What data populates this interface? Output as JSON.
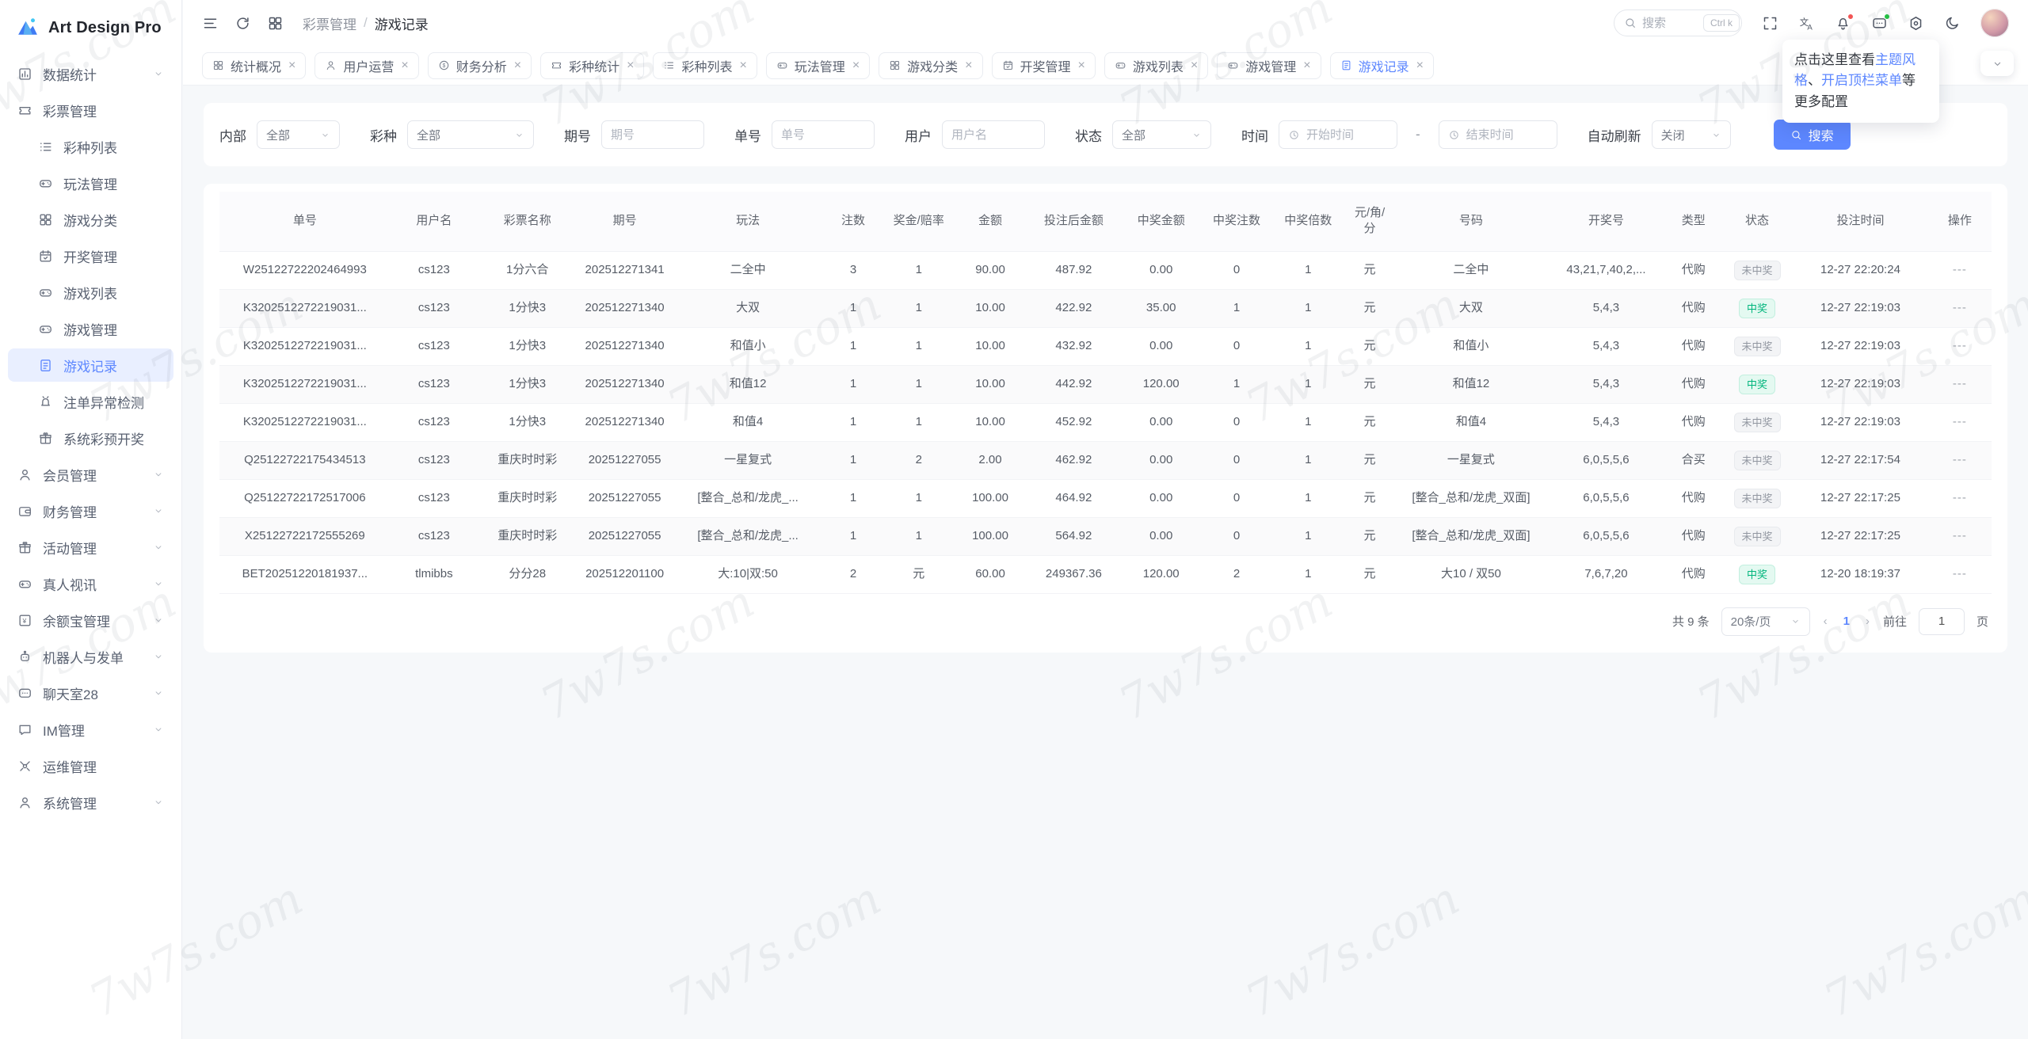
{
  "app": {
    "name": "Art Design Pro"
  },
  "watermark_text": "7w7s.com",
  "colors": {
    "accent": "#5d87ff",
    "win_text": "#00b57c",
    "win_bg": "#e4f9f1",
    "lose_text": "#9297a1",
    "lose_bg": "#f3f4f6",
    "dot_red": "#f25555",
    "dot_green": "#23c343"
  },
  "sidebar": {
    "items": [
      {
        "label": "数据统计",
        "icon": "bar-chart-icon",
        "level": 1,
        "chevron": true,
        "active": false
      },
      {
        "label": "彩票管理",
        "icon": "ticket-icon",
        "level": 1,
        "chevron": false,
        "active": false
      },
      {
        "label": "彩种列表",
        "icon": "list-icon",
        "level": 2,
        "chevron": false,
        "active": false
      },
      {
        "label": "玩法管理",
        "icon": "gamepad-icon",
        "level": 2,
        "chevron": false,
        "active": false
      },
      {
        "label": "游戏分类",
        "icon": "grid-icon",
        "level": 2,
        "chevron": false,
        "active": false
      },
      {
        "label": "开奖管理",
        "icon": "calendar-check-icon",
        "level": 2,
        "chevron": false,
        "active": false
      },
      {
        "label": "游戏列表",
        "icon": "gamepad-icon",
        "level": 2,
        "chevron": false,
        "active": false
      },
      {
        "label": "游戏管理",
        "icon": "gamepad-icon",
        "level": 2,
        "chevron": false,
        "active": false
      },
      {
        "label": "游戏记录",
        "icon": "document-icon",
        "level": 2,
        "chevron": false,
        "active": true
      },
      {
        "label": "注单异常检测",
        "icon": "alarm-icon",
        "level": 2,
        "chevron": false,
        "active": false
      },
      {
        "label": "系统彩预开奖",
        "icon": "gift-icon",
        "level": 2,
        "chevron": false,
        "active": false
      },
      {
        "label": "会员管理",
        "icon": "user-icon",
        "level": 1,
        "chevron": true,
        "active": false
      },
      {
        "label": "财务管理",
        "icon": "wallet-icon",
        "level": 1,
        "chevron": true,
        "active": false
      },
      {
        "label": "活动管理",
        "icon": "gift-icon",
        "level": 1,
        "chevron": true,
        "active": false
      },
      {
        "label": "真人视讯",
        "icon": "gamepad-icon",
        "level": 1,
        "chevron": true,
        "active": false
      },
      {
        "label": "余额宝管理",
        "icon": "yuan-icon",
        "level": 1,
        "chevron": true,
        "active": false
      },
      {
        "label": "机器人与发单",
        "icon": "robot-icon",
        "level": 1,
        "chevron": true,
        "active": false
      },
      {
        "label": "聊天室28",
        "icon": "chat-dots-icon",
        "level": 1,
        "chevron": true,
        "active": false
      },
      {
        "label": "IM管理",
        "icon": "message-icon",
        "level": 1,
        "chevron": true,
        "active": false
      },
      {
        "label": "运维管理",
        "icon": "tools-icon",
        "level": 1,
        "chevron": false,
        "active": false
      },
      {
        "label": "系统管理",
        "icon": "user-icon",
        "level": 1,
        "chevron": true,
        "active": false
      }
    ]
  },
  "topbar": {
    "breadcrumb": [
      "彩票管理",
      "游戏记录"
    ],
    "breadcrumb_separator": "/",
    "search": {
      "placeholder": "搜索",
      "shortcut": "Ctrl k"
    }
  },
  "tabs": [
    {
      "label": "统计概况",
      "icon": "grid-icon",
      "active": false
    },
    {
      "label": "用户运营",
      "icon": "user-icon",
      "active": false
    },
    {
      "label": "财务分析",
      "icon": "dollar-circle-icon",
      "active": false
    },
    {
      "label": "彩种统计",
      "icon": "ticket-icon",
      "active": false
    },
    {
      "label": "彩种列表",
      "icon": "list-icon",
      "active": false
    },
    {
      "label": "玩法管理",
      "icon": "gamepad-icon",
      "active": false
    },
    {
      "label": "游戏分类",
      "icon": "grid-icon",
      "active": false
    },
    {
      "label": "开奖管理",
      "icon": "calendar-check-icon",
      "active": false
    },
    {
      "label": "游戏列表",
      "icon": "gamepad-icon",
      "active": false
    },
    {
      "label": "游戏管理",
      "icon": "gamepad-icon",
      "active": false
    },
    {
      "label": "游戏记录",
      "icon": "document-icon",
      "active": true
    }
  ],
  "tab_close_glyph": "×",
  "tooltip": {
    "prefix": "点击这里查看",
    "link_theme": "主题风格",
    "separator": "、",
    "link_topbar": "开启顶栏菜单",
    "suffix": "等更多配置"
  },
  "filters": {
    "fields": [
      {
        "label": "内部",
        "type": "select",
        "value": "全部"
      },
      {
        "label": "彩种",
        "type": "select",
        "value": "全部"
      },
      {
        "label": "期号",
        "type": "input",
        "placeholder": "期号"
      },
      {
        "label": "单号",
        "type": "input",
        "placeholder": "单号"
      },
      {
        "label": "用户",
        "type": "input",
        "placeholder": "用户名"
      },
      {
        "label": "状态",
        "type": "select",
        "value": "全部"
      },
      {
        "label": "时间",
        "type": "daterange",
        "start_placeholder": "开始时间",
        "end_placeholder": "结束时间",
        "separator": "-"
      },
      {
        "label": "自动刷新",
        "type": "select",
        "value": "关闭"
      }
    ],
    "search_button": "搜索"
  },
  "table": {
    "columns": [
      "单号",
      "用户名",
      "彩票名称",
      "期号",
      "玩法",
      "注数",
      "奖金/赔率",
      "金额",
      "投注后金额",
      "中奖金额",
      "中奖注数",
      "中奖倍数",
      "元/角/分",
      "号码",
      "开奖号",
      "类型",
      "状态",
      "投注时间",
      "操作"
    ],
    "status_win": "中奖",
    "rows": [
      [
        "W25122722202464993",
        "cs123",
        "1分六合",
        "202512271341",
        "二全中",
        "3",
        "1",
        "90.00",
        "487.92",
        "0.00",
        "0",
        "1",
        "元",
        "二全中",
        "43,21,7,40,2,...",
        "代购",
        "未中奖",
        "12-27 22:20:24",
        "---"
      ],
      [
        "K3202512272219031...",
        "cs123",
        "1分快3",
        "202512271340",
        "大双",
        "1",
        "1",
        "10.00",
        "422.92",
        "35.00",
        "1",
        "1",
        "元",
        "大双",
        "5,4,3",
        "代购",
        "中奖",
        "12-27 22:19:03",
        "---"
      ],
      [
        "K3202512272219031...",
        "cs123",
        "1分快3",
        "202512271340",
        "和值小",
        "1",
        "1",
        "10.00",
        "432.92",
        "0.00",
        "0",
        "1",
        "元",
        "和值小",
        "5,4,3",
        "代购",
        "未中奖",
        "12-27 22:19:03",
        "---"
      ],
      [
        "K3202512272219031...",
        "cs123",
        "1分快3",
        "202512271340",
        "和值12",
        "1",
        "1",
        "10.00",
        "442.92",
        "120.00",
        "1",
        "1",
        "元",
        "和值12",
        "5,4,3",
        "代购",
        "中奖",
        "12-27 22:19:03",
        "---"
      ],
      [
        "K3202512272219031...",
        "cs123",
        "1分快3",
        "202512271340",
        "和值4",
        "1",
        "1",
        "10.00",
        "452.92",
        "0.00",
        "0",
        "1",
        "元",
        "和值4",
        "5,4,3",
        "代购",
        "未中奖",
        "12-27 22:19:03",
        "---"
      ],
      [
        "Q25122722175434513",
        "cs123",
        "重庆时时彩",
        "20251227055",
        "一星复式",
        "1",
        "2",
        "2.00",
        "462.92",
        "0.00",
        "0",
        "1",
        "元",
        "一星复式",
        "6,0,5,5,6",
        "合买",
        "未中奖",
        "12-27 22:17:54",
        "---"
      ],
      [
        "Q25122722172517006",
        "cs123",
        "重庆时时彩",
        "20251227055",
        "[整合_总和/龙虎_...",
        "1",
        "1",
        "100.00",
        "464.92",
        "0.00",
        "0",
        "1",
        "元",
        "[整合_总和/龙虎_双面]",
        "6,0,5,5,6",
        "代购",
        "未中奖",
        "12-27 22:17:25",
        "---"
      ],
      [
        "X25122722172555269",
        "cs123",
        "重庆时时彩",
        "20251227055",
        "[整合_总和/龙虎_...",
        "1",
        "1",
        "100.00",
        "564.92",
        "0.00",
        "0",
        "1",
        "元",
        "[整合_总和/龙虎_双面]",
        "6,0,5,5,6",
        "代购",
        "未中奖",
        "12-27 22:17:25",
        "---"
      ],
      [
        "BET20251220181937...",
        "tlmibbs",
        "分分28",
        "202512201100",
        "大:10|双:50",
        "2",
        "元",
        "60.00",
        "249367.36",
        "120.00",
        "2",
        "1",
        "元",
        "大10 / 双50",
        "7,6,7,20",
        "代购",
        "中奖",
        "12-20 18:19:37",
        "---"
      ]
    ]
  },
  "pagination": {
    "total": "共 9 条",
    "page_size": "20条/页",
    "current_page": "1",
    "prev_glyph": "‹",
    "next_glyph": "›",
    "goto_label": "前往",
    "page_unit": "页"
  }
}
